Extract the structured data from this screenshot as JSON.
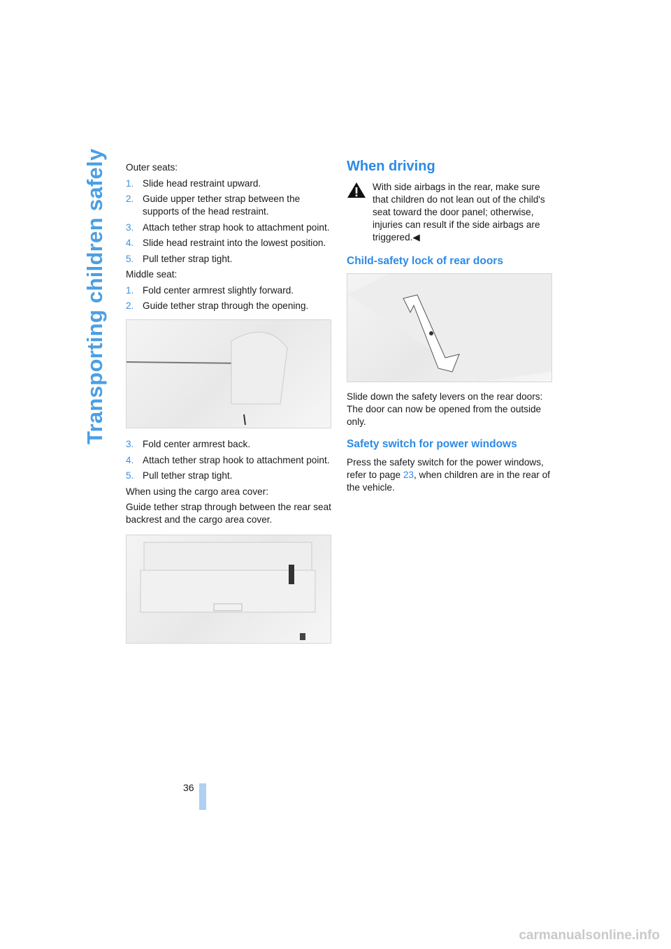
{
  "section_title": "Transporting children safely",
  "left": {
    "outer_label": "Outer seats:",
    "outer_steps": [
      {
        "n": "1.",
        "t": "Slide head restraint upward."
      },
      {
        "n": "2.",
        "t": "Guide upper tether strap between the supports of the head restraint."
      },
      {
        "n": "3.",
        "t": "Attach tether strap hook to attachment point."
      },
      {
        "n": "4.",
        "t": "Slide head restraint into the lowest position."
      },
      {
        "n": "5.",
        "t": "Pull tether strap tight."
      }
    ],
    "middle_label": "Middle seat:",
    "middle_steps": [
      {
        "n": "1.",
        "t": "Fold center armrest slightly forward."
      },
      {
        "n": "2.",
        "t": "Guide tether strap through the opening."
      },
      {
        "n": "3.",
        "t": "Fold center armrest back."
      },
      {
        "n": "4.",
        "t": "Attach tether strap hook to attachment point."
      },
      {
        "n": "5.",
        "t": "Pull tether strap tight."
      }
    ],
    "cargo_label": "When using the cargo area cover:",
    "cargo_text": "Guide tether strap through between the rear seat backrest and the cargo area cover."
  },
  "right": {
    "heading": "When driving",
    "warning": "With side airbags in the rear, make sure that children do not lean out of the child's seat toward the door panel; otherwise, injuries can result if the side airbags are triggered.◀",
    "lock_heading": "Child-safety lock of rear doors",
    "lock_text": "Slide down the safety levers on the rear doors: The door can now be opened from the outside only.",
    "switch_heading": "Safety switch for power windows",
    "switch_text_before": "Press the safety switch for the power windows, refer to page ",
    "switch_link": "23",
    "switch_text_after": ", when children are in the rear of the vehicle."
  },
  "page_number": "36",
  "watermark": "carmanualsonline.info",
  "colors": {
    "accent": "#2c8ae6",
    "side_title": "#4a9fe6"
  }
}
